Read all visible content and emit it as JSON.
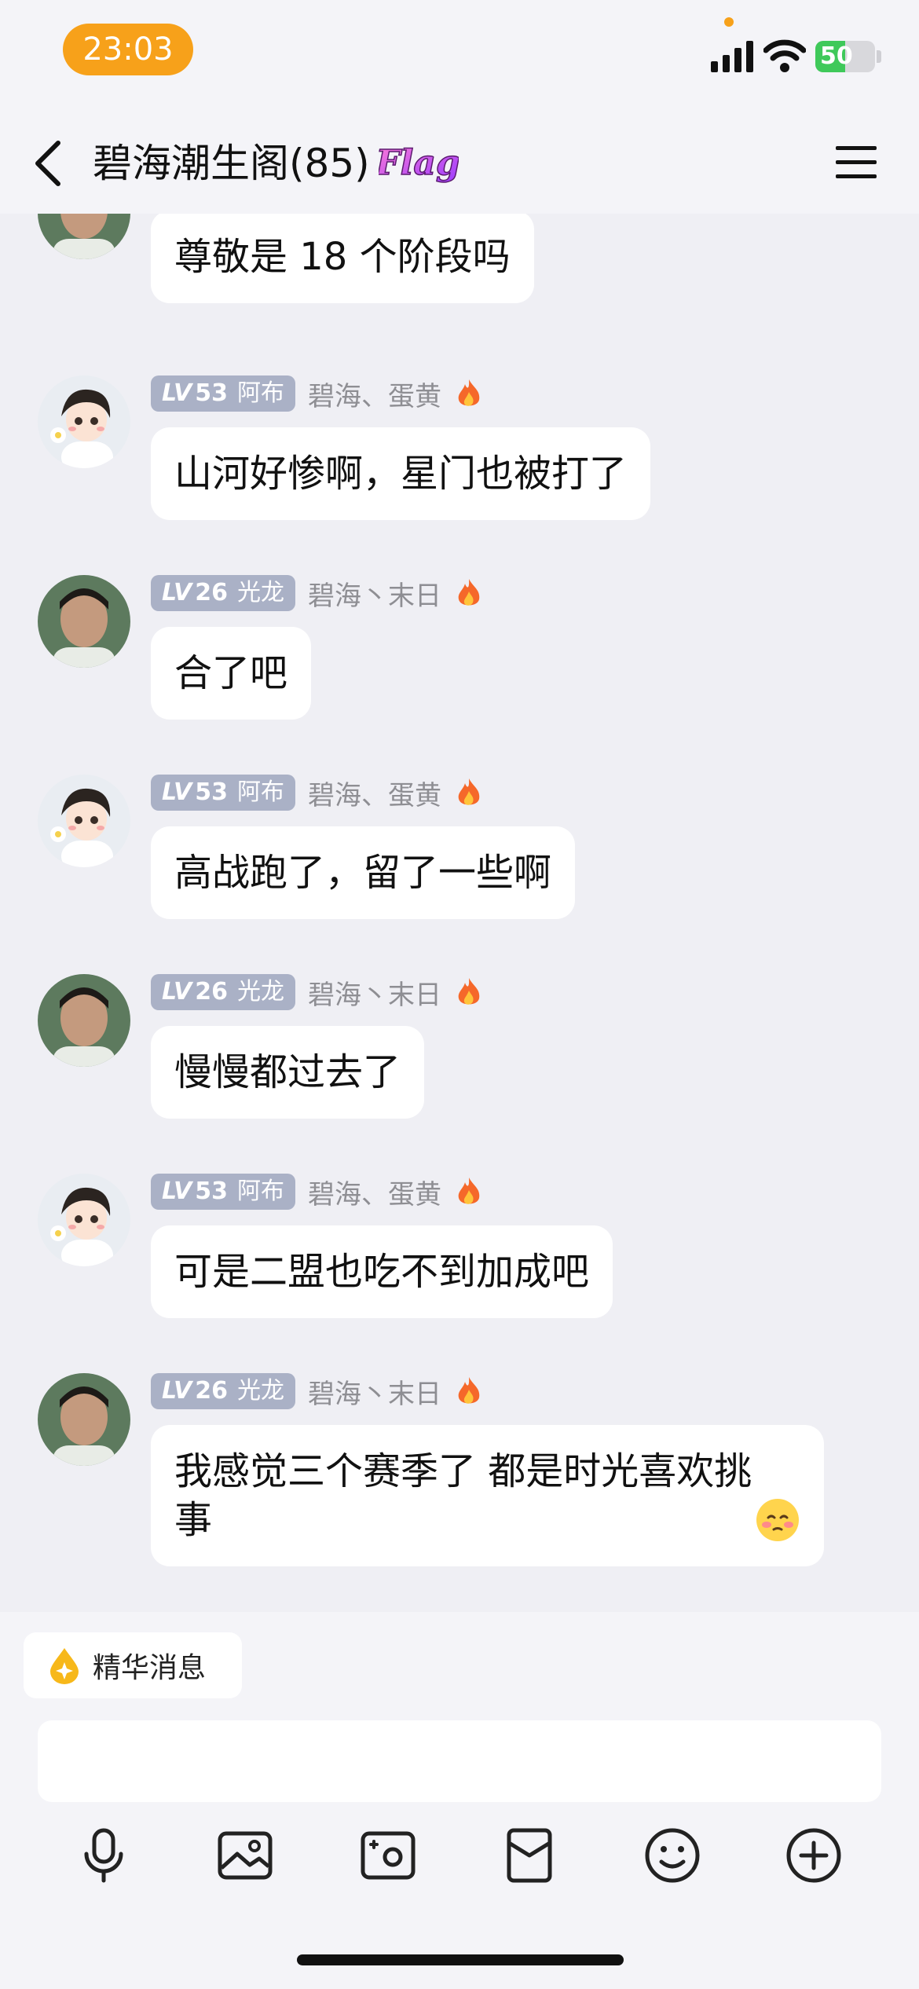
{
  "status_bar": {
    "time": "23:03",
    "battery": "50",
    "battery_level": 0.5
  },
  "header": {
    "title": "碧海潮生阁(85)",
    "badge_text": "Flag"
  },
  "messages": [
    {
      "text": "尊敬是 18 个阶段吗",
      "avatar": "boy-photo"
    },
    {
      "lv_prefix": "LV",
      "level": "53",
      "title": "阿布",
      "name": "碧海、蛋黄",
      "text": "山河好惨啊，星门也被打了",
      "avatar": "anime-boy"
    },
    {
      "lv_prefix": "LV",
      "level": "26",
      "title": "光龙",
      "name": "碧海丶末日",
      "text": "合了吧",
      "avatar": "boy-photo"
    },
    {
      "lv_prefix": "LV",
      "level": "53",
      "title": "阿布",
      "name": "碧海、蛋黄",
      "text": "高战跑了，留了一些啊",
      "avatar": "anime-boy"
    },
    {
      "lv_prefix": "LV",
      "level": "26",
      "title": "光龙",
      "name": "碧海丶末日",
      "text": "慢慢都过去了",
      "avatar": "boy-photo"
    },
    {
      "lv_prefix": "LV",
      "level": "53",
      "title": "阿布",
      "name": "碧海、蛋黄",
      "text": "可是二盟也吃不到加成吧",
      "avatar": "anime-boy"
    },
    {
      "lv_prefix": "LV",
      "level": "26",
      "title": "光龙",
      "name": "碧海丶末日",
      "text": "我感觉三个赛季了 都是时光喜欢挑\n事",
      "avatar": "boy-photo"
    }
  ],
  "essence": {
    "label": "精华消息"
  },
  "input": {
    "value": ""
  },
  "toolbar": [
    "microphone-icon",
    "image-icon",
    "camera-icon",
    "red-packet-icon",
    "emoji-icon",
    "plus-icon"
  ],
  "colors": {
    "accent": "#f7a11a",
    "bubble": "#ffffff",
    "background": "#efeff4",
    "level_badge": "#aab1c6",
    "battery": "#3fc95a"
  }
}
